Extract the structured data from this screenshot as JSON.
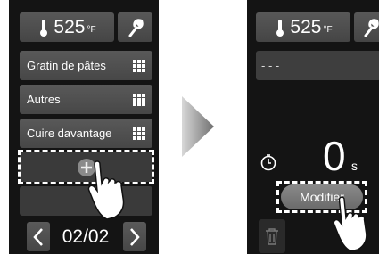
{
  "left_panel": {
    "temperature": "525",
    "temperature_unit": "°F",
    "menu_items": [
      {
        "label": "Gratin de pâtes"
      },
      {
        "label": "Autres"
      },
      {
        "label": "Cuire davantage"
      }
    ],
    "page_indicator": "02/02"
  },
  "right_panel": {
    "temperature": "525",
    "temperature_unit": "°F",
    "recipe_name": "- - -",
    "time_value": "0",
    "time_unit": "s",
    "modify_label": "Modifier"
  },
  "icons": {
    "thermometer": "thermometer-icon",
    "wrench": "wrench-icon",
    "grid": "grid-icon",
    "add": "plus-circle-icon",
    "prev": "chevron-left-icon",
    "next": "chevron-right-icon",
    "timer": "timer-icon",
    "trash": "trash-icon",
    "hand": "hand-pointer-icon",
    "transition": "arrow-right-icon"
  }
}
